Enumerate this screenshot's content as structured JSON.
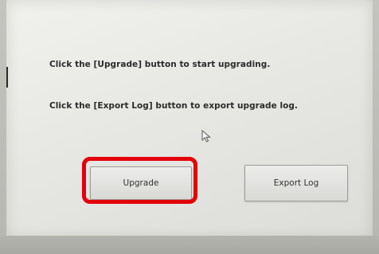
{
  "instructions": {
    "upgrade_text": "Click the [Upgrade] button to start upgrading.",
    "export_text": "Click the [Export Log] button to export upgrade log."
  },
  "buttons": {
    "upgrade_label": "Upgrade",
    "export_label": "Export Log"
  },
  "icons": {
    "cursor": "mouse-pointer-icon"
  },
  "colors": {
    "highlight": "#e3000b",
    "screen_bg": "#ebebe8",
    "text": "#2b2b2b"
  }
}
